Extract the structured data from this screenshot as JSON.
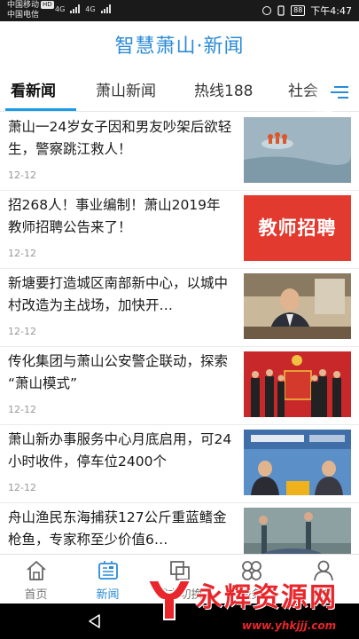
{
  "status_bar": {
    "carrier_1": "中国移动",
    "hd_badge": "HD",
    "carrier_2": "中国电信",
    "network_1": "4G",
    "network_2": "4G",
    "battery": "88",
    "time": "下午4:47"
  },
  "header": {
    "title": "智慧萧山·新闻"
  },
  "tabs": [
    {
      "label": "看新闻",
      "active": true
    },
    {
      "label": "萧山新闻",
      "active": false
    },
    {
      "label": "热线188",
      "active": false
    },
    {
      "label": "社会",
      "active": false
    }
  ],
  "news": [
    {
      "title": "萧山一24岁女子因和男友吵架后欲轻生，警察跳江救人！",
      "date": "12-12",
      "thumb": "river-rescue"
    },
    {
      "title": "招268人！事业编制！萧山2019年教师招聘公告来了！",
      "date": "12-12",
      "thumb": "teacher-recruit",
      "thumb_text": "教师招聘"
    },
    {
      "title": "新塘要打造城区南部新中心，以城中村改造为主战场，加快开…",
      "date": "12-12",
      "thumb": "official-portrait"
    },
    {
      "title": "传化集团与萧山公安警企联动，探索 “萧山模式”",
      "date": "12-12",
      "thumb": "award-ceremony"
    },
    {
      "title": "萧山新办事服务中心月底启用，可24小时收件，停车位2400个",
      "date": "12-12",
      "thumb": "tv-news"
    },
    {
      "title": "舟山渔民东海捕获127公斤重蓝鳍金枪鱼，专家称至少价值6…",
      "date": "12-12",
      "thumb": "fish-catch"
    }
  ],
  "bottom_nav": [
    {
      "label": "首页",
      "icon": "home-icon",
      "active": false
    },
    {
      "label": "新闻",
      "icon": "news-icon",
      "active": true
    },
    {
      "label": "城市切换",
      "icon": "city-switch-icon",
      "active": false
    },
    {
      "label": "服务",
      "icon": "services-icon",
      "active": false
    },
    {
      "label": "我的",
      "icon": "profile-icon",
      "active": false
    }
  ],
  "watermark": {
    "text": "永辉资源网",
    "url": "www.yhkjjj.com"
  },
  "colors": {
    "accent": "#2b8bd6",
    "tab_underline": "#1c9be6",
    "watermark": "#e8262b"
  }
}
